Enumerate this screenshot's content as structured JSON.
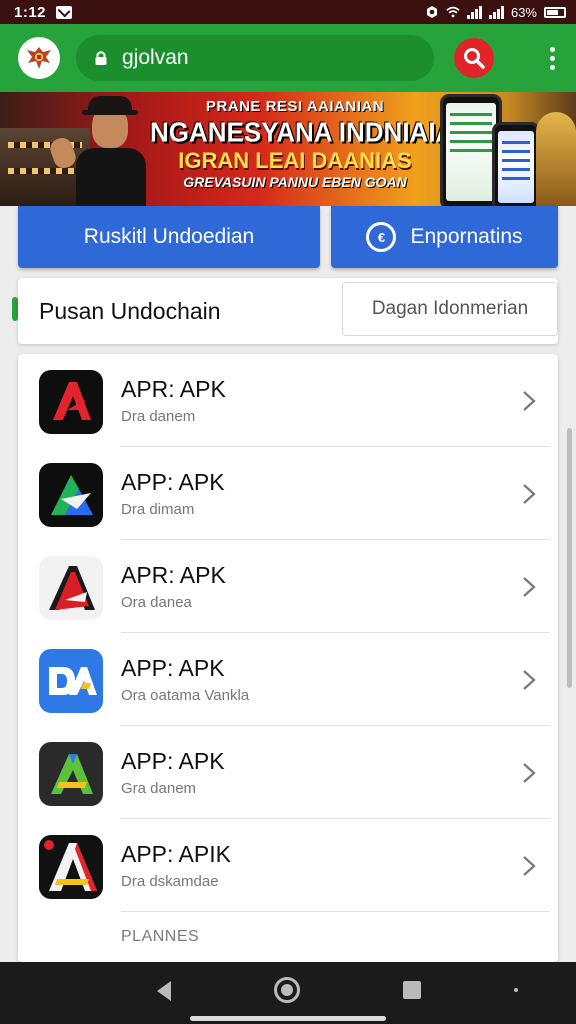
{
  "status_bar": {
    "time": "1:12",
    "battery": "63%"
  },
  "browser": {
    "url_text": "gjolvan"
  },
  "banner": {
    "line1": "PRANE RESI AAIANIAN",
    "line2": "NGANESYANA INDNIAIASI",
    "line3": "IGRAN LEAI DAANIAS",
    "line4": "GREVASUIN PANNU EBEN GOAN"
  },
  "actions": {
    "primary_label": "Ruskitl Undoedian",
    "secondary_label": "Enpornatins"
  },
  "section": {
    "title": "Pusan Undochain",
    "subtitle_button": "Dagan Idonmerian"
  },
  "apps": [
    {
      "name": "APR: APK",
      "subtitle": "Dra danem",
      "icon": "red-a-icon",
      "colors": [
        "#0e0e0e",
        "#e3242b"
      ]
    },
    {
      "name": "APP: APK",
      "subtitle": "Dra dimam",
      "icon": "green-blue-a-icon",
      "colors": [
        "#0e0e0e",
        "#22b35a",
        "#2a6cf0"
      ]
    },
    {
      "name": "APR: APK",
      "subtitle": "Ora danea",
      "icon": "white-red-a-icon",
      "colors": [
        "#f2f2f2",
        "#d81f26"
      ]
    },
    {
      "name": "APP: APK",
      "subtitle": "Ora oatama Vankla",
      "icon": "blue-da-icon",
      "colors": [
        "#2f79e6",
        "#ffffff"
      ]
    },
    {
      "name": "APP: APK",
      "subtitle": "Gra danem",
      "icon": "green-a-icon",
      "colors": [
        "#2a2a2a",
        "#5cc23b"
      ]
    },
    {
      "name": "APP: APIK",
      "subtitle": "Dra dskamdae",
      "icon": "red-yellow-a-icon",
      "colors": [
        "#111111",
        "#e3242b",
        "#f5c21b"
      ]
    }
  ],
  "list_footer": "PLANNES",
  "colors": {
    "app_bar": "#27a33b",
    "accent_red": "#e1232a",
    "button_blue": "#2f69d8",
    "status_bar": "#3a1010"
  }
}
